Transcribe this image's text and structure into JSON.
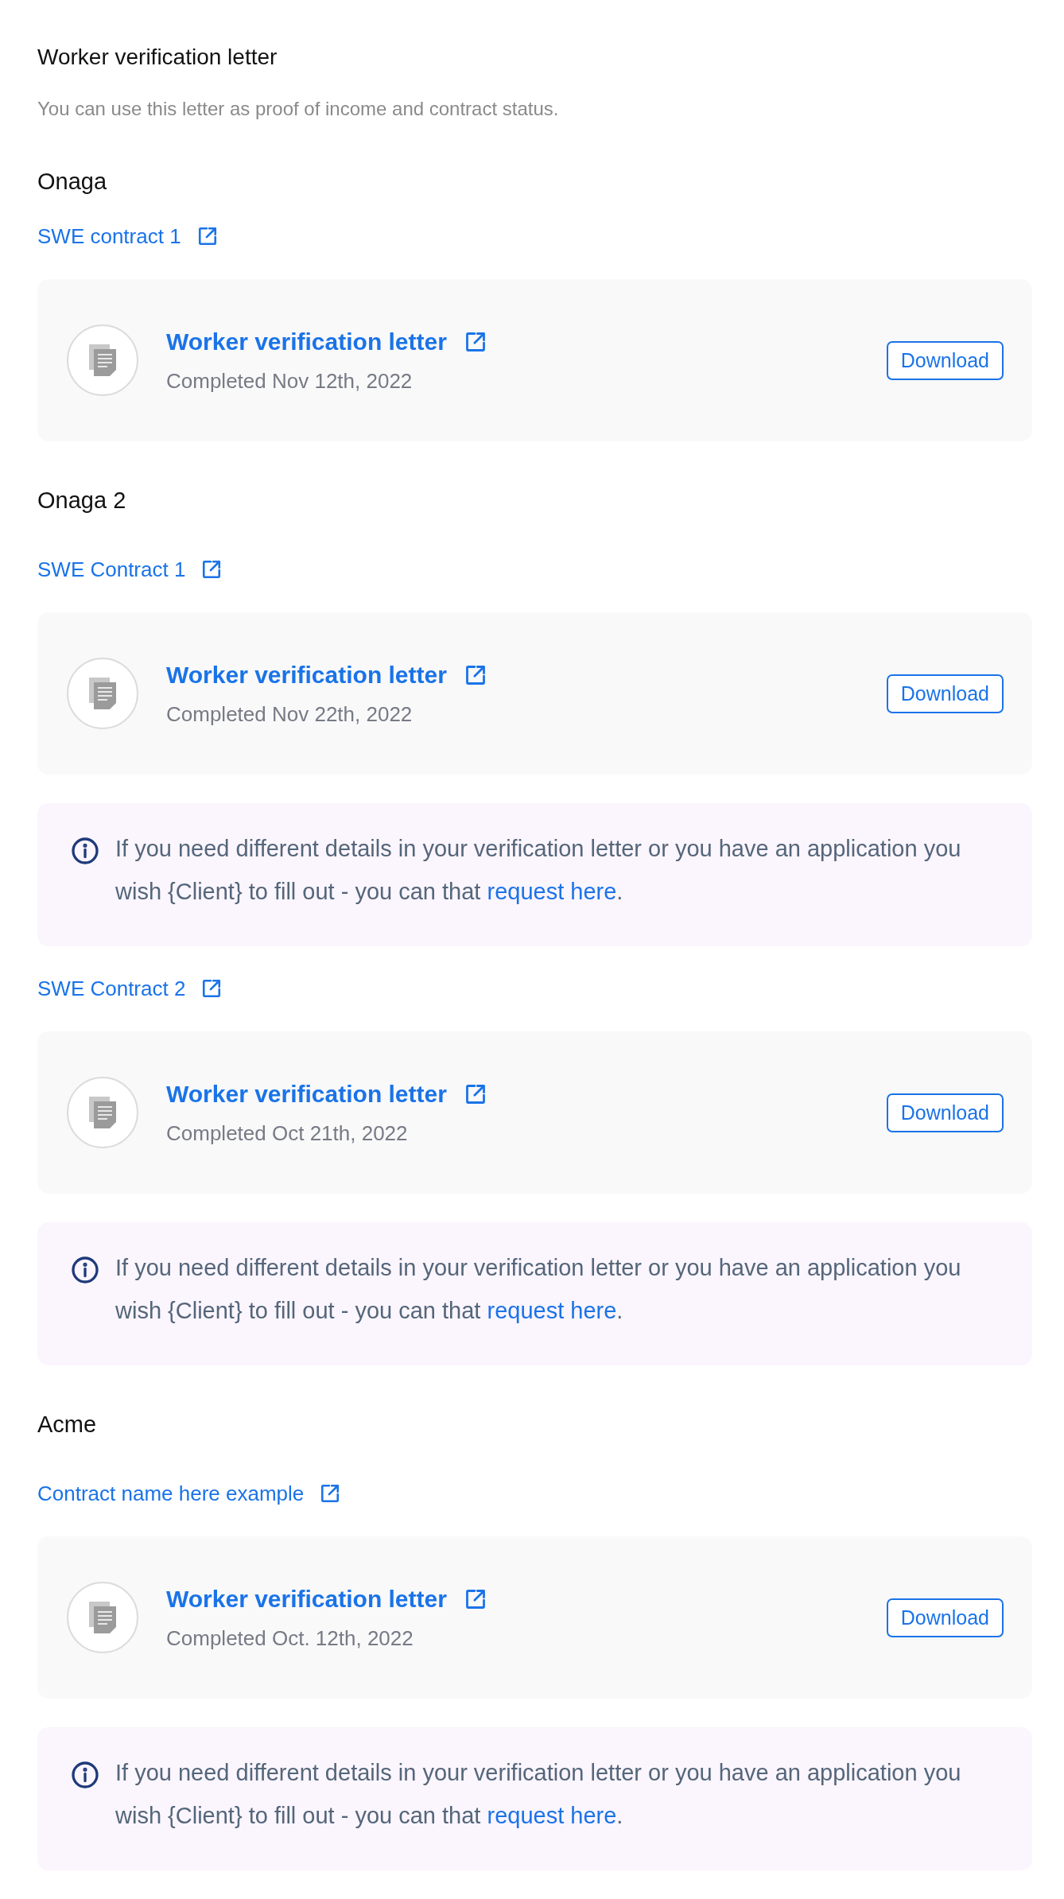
{
  "title": "Worker verification letter",
  "subtitle": "You can use this letter as proof of income and contract status.",
  "clients": [
    {
      "name": "Onaga",
      "contracts": [
        {
          "label": "SWE contract 1",
          "letters": [
            {
              "title": "Worker verification letter",
              "date": "Completed Nov 12th, 2022",
              "action": "Download"
            }
          ]
        }
      ]
    },
    {
      "name": "Onaga 2",
      "contracts": [
        {
          "label": "SWE Contract 1",
          "letters": [
            {
              "title": "Worker verification letter",
              "date": "Completed Nov 22th, 2022",
              "action": "Download"
            }
          ],
          "note": {
            "text": "If you need different details in your verification letter or you have an application you wish {Client} to fill out - you can that ",
            "link": "request here",
            "end": "."
          }
        },
        {
          "label": "SWE Contract 2",
          "letters": [
            {
              "title": "Worker verification letter",
              "date": "Completed Oct 21th, 2022",
              "action": "Download"
            }
          ],
          "note": {
            "text": "If you need different details in your verification letter or you have an application you wish {Client} to fill out - you can that ",
            "link": "request here",
            "end": "."
          }
        }
      ]
    },
    {
      "name": "Acme",
      "contracts": [
        {
          "label": "Contract name here example",
          "letters": [
            {
              "title": "Worker verification letter",
              "date": "Completed Oct. 12th, 2022",
              "action": "Download"
            }
          ],
          "note": {
            "text": "If you need different details in your verification letter or you have an application you wish {Client} to fill out - you can that ",
            "link": "request here",
            "end": "."
          }
        }
      ]
    }
  ]
}
